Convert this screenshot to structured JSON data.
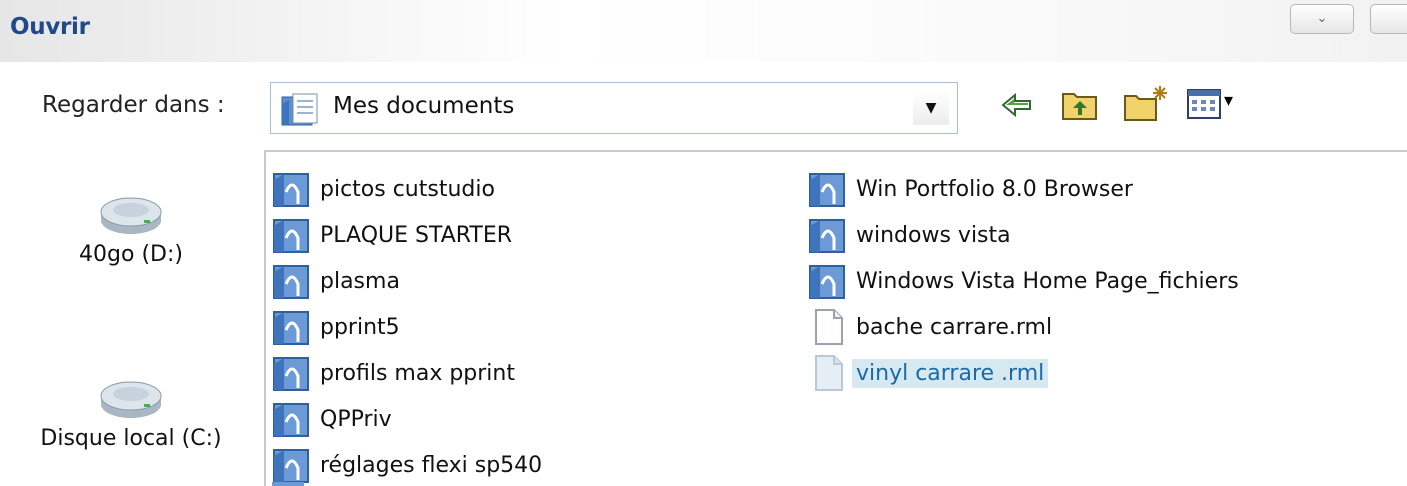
{
  "window": {
    "title": "Ouvrir",
    "title_color": "#1e4a8c",
    "control_glyph": "⌄"
  },
  "lookin": {
    "label": "Regarder dans :",
    "value": "Mes documents",
    "icon": "my-documents-folder-icon",
    "dropdown_glyph": "▼"
  },
  "toolbar": {
    "items": [
      {
        "name": "back-icon",
        "glyph": "⇦"
      },
      {
        "name": "up-folder-icon"
      },
      {
        "name": "new-folder-icon"
      },
      {
        "name": "view-menu-icon",
        "glyph": "▾"
      }
    ]
  },
  "places": [
    {
      "label": "40go  (D:)",
      "icon": "hard-drive-icon"
    },
    {
      "label": "Disque local (C:)",
      "icon": "hard-drive-icon"
    }
  ],
  "files": {
    "column1": [
      {
        "name": "pictos cutstudio",
        "type": "folder"
      },
      {
        "name": "PLAQUE STARTER",
        "type": "folder"
      },
      {
        "name": "plasma",
        "type": "folder"
      },
      {
        "name": "pprint5",
        "type": "folder"
      },
      {
        "name": "profils max pprint",
        "type": "folder"
      },
      {
        "name": "QPPriv",
        "type": "folder"
      },
      {
        "name": "réglages flexi sp540",
        "type": "folder"
      }
    ],
    "column2": [
      {
        "name": "Win Portfolio 8.0 Browser",
        "type": "folder"
      },
      {
        "name": "windows vista",
        "type": "folder"
      },
      {
        "name": "Windows Vista Home Page_fichiers",
        "type": "folder"
      },
      {
        "name": "bache carrare.rml",
        "type": "file"
      },
      {
        "name": "vinyl carrare .rml",
        "type": "file",
        "selected": true
      }
    ]
  },
  "colors": {
    "selection_bg": "#d6e8f0",
    "selection_text": "#1a6aa8",
    "folder_blue": "#4f86c6"
  }
}
